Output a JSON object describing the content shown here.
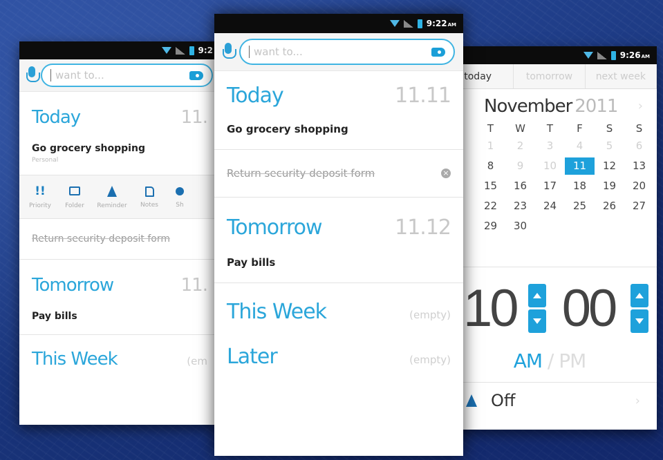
{
  "left_phone": {
    "status_time": "9:2",
    "search_placeholder": "want to...",
    "today_title": "Today",
    "today_date": "11.",
    "task1": "Go grocery shopping",
    "task1_category": "Personal",
    "actions": [
      {
        "label": "Priority",
        "icon": "priority-icon"
      },
      {
        "label": "Folder",
        "icon": "folder-icon"
      },
      {
        "label": "Reminder",
        "icon": "bell-icon"
      },
      {
        "label": "Notes",
        "icon": "note-icon"
      },
      {
        "label": "Sh",
        "icon": "person-icon"
      }
    ],
    "task2": "Return security deposit form",
    "tomorrow_title": "Tomorrow",
    "tomorrow_date": "11.",
    "task3": "Pay bills",
    "thisweek_title": "This Week",
    "thisweek_empty": "(em"
  },
  "center_phone": {
    "status_time": "9:22",
    "status_ampm": "AM",
    "search_placeholder": "want to...",
    "today_title": "Today",
    "today_date": "11.11",
    "task1": "Go grocery shopping",
    "task2": "Return security deposit form",
    "tomorrow_title": "Tomorrow",
    "tomorrow_date": "11.12",
    "task3": "Pay bills",
    "thisweek_title": "This Week",
    "thisweek_empty": "(empty)",
    "later_title": "Later",
    "later_empty": "(empty)"
  },
  "right_phone": {
    "status_time": "9:26",
    "status_ampm": "AM",
    "tabs": [
      "today",
      "tomorrow",
      "next week"
    ],
    "month": "November",
    "year": "2011",
    "weekdays": [
      "T",
      "W",
      "T",
      "F",
      "S",
      "S"
    ],
    "weeks": [
      [
        "1",
        "2",
        "3",
        "4",
        "5",
        "6"
      ],
      [
        "8",
        "9",
        "10",
        "11",
        "12",
        "13"
      ],
      [
        "15",
        "16",
        "17",
        "18",
        "19",
        "20"
      ],
      [
        "22",
        "23",
        "24",
        "25",
        "26",
        "27"
      ],
      [
        "29",
        "30",
        "",
        "",
        "",
        ""
      ]
    ],
    "muted_rows": [
      0
    ],
    "muted_cells": [
      "9",
      "10"
    ],
    "selected_day": "11",
    "hour": "10",
    "minute": "00",
    "am": "AM",
    "pm": "PM",
    "reminder_state": "Off"
  },
  "colors": {
    "accent": "#2ba6da",
    "selected": "#1ea1db",
    "background": "#1d3b86"
  }
}
